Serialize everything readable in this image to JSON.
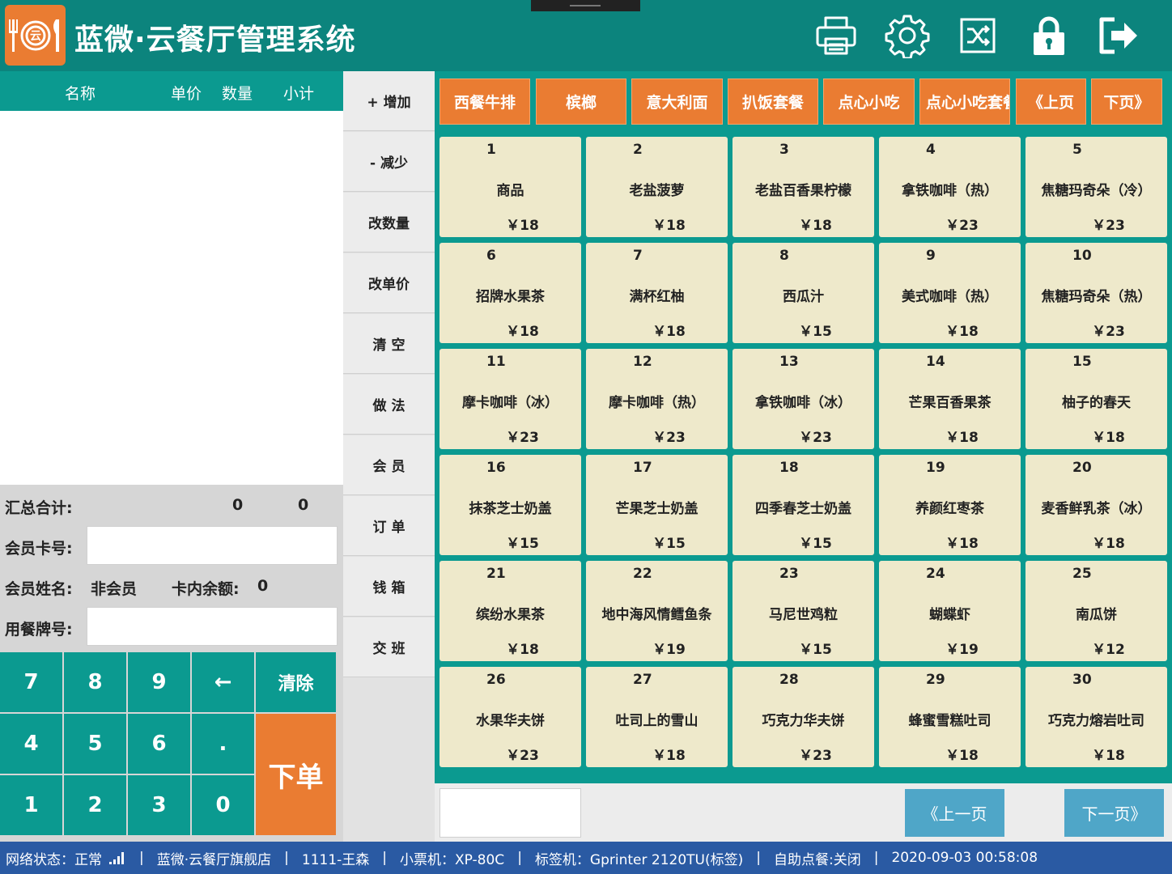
{
  "header": {
    "title": "蓝微·云餐厅管理系统",
    "icons": [
      "printer-icon",
      "settings-gear-icon",
      "shuffle-icon",
      "lock-icon",
      "exit-icon"
    ]
  },
  "order_table": {
    "col_name": "名称",
    "col_price": "单价",
    "col_qty": "数量",
    "col_subtotal": "小计"
  },
  "summary": {
    "total_label": "汇总合计:",
    "total_qty": "0",
    "total_amount": "0",
    "card_label": "会员卡号:",
    "member_name_label": "会员姓名:",
    "member_name": "非会员",
    "balance_label": "卡内余额:",
    "balance": "0",
    "table_tag_label": "用餐牌号:"
  },
  "numpad": {
    "k7": "7",
    "k8": "8",
    "k9": "9",
    "back": "←",
    "clear": "清除",
    "k4": "4",
    "k5": "5",
    "k6": "6",
    "dot": ".",
    "k1": "1",
    "k2": "2",
    "k3": "3",
    "k0": "0",
    "submit": "下单"
  },
  "actions": [
    "+ 增加",
    "- 减少",
    "改数量",
    "改单价",
    "清 空",
    "做 法",
    "会 员",
    "订 单",
    "钱 箱",
    "交 班"
  ],
  "categories": [
    "西餐牛排",
    "槟榔",
    "意大利面",
    "扒饭套餐",
    "点心小吃",
    "点心小吃套餐",
    "《上页",
    "下页》"
  ],
  "products": [
    {
      "num": "1",
      "name": "商品",
      "price": "￥18"
    },
    {
      "num": "2",
      "name": "老盐菠萝",
      "price": "￥18"
    },
    {
      "num": "3",
      "name": "老盐百香果柠檬",
      "price": "￥18"
    },
    {
      "num": "4",
      "name": "拿铁咖啡（热）",
      "price": "￥23"
    },
    {
      "num": "5",
      "name": "焦糖玛奇朵（冷）",
      "price": "￥23"
    },
    {
      "num": "6",
      "name": "招牌水果茶",
      "price": "￥18"
    },
    {
      "num": "7",
      "name": "满杯红柚",
      "price": "￥18"
    },
    {
      "num": "8",
      "name": "西瓜汁",
      "price": "￥15"
    },
    {
      "num": "9",
      "name": "美式咖啡（热）",
      "price": "￥18"
    },
    {
      "num": "10",
      "name": "焦糖玛奇朵（热）",
      "price": "￥23"
    },
    {
      "num": "11",
      "name": "摩卡咖啡（冰）",
      "price": "￥23"
    },
    {
      "num": "12",
      "name": "摩卡咖啡（热）",
      "price": "￥23"
    },
    {
      "num": "13",
      "name": "拿铁咖啡（冰）",
      "price": "￥23"
    },
    {
      "num": "14",
      "name": "芒果百香果茶",
      "price": "￥18"
    },
    {
      "num": "15",
      "name": "柚子的春天",
      "price": "￥18"
    },
    {
      "num": "16",
      "name": "抹茶芝士奶盖",
      "price": "￥15"
    },
    {
      "num": "17",
      "name": "芒果芝士奶盖",
      "price": "￥15"
    },
    {
      "num": "18",
      "name": "四季春芝士奶盖",
      "price": "￥15"
    },
    {
      "num": "19",
      "name": "养颜红枣茶",
      "price": "￥18"
    },
    {
      "num": "20",
      "name": "麦香鲜乳茶（冰）",
      "price": "￥18"
    },
    {
      "num": "21",
      "name": "缤纷水果茶",
      "price": "￥18"
    },
    {
      "num": "22",
      "name": "地中海风情鳕鱼条",
      "price": "￥19"
    },
    {
      "num": "23",
      "name": "马尼世鸡粒",
      "price": "￥15"
    },
    {
      "num": "24",
      "name": "蝴蝶虾",
      "price": "￥19"
    },
    {
      "num": "25",
      "name": "南瓜饼",
      "price": "￥12"
    },
    {
      "num": "26",
      "name": "水果华夫饼",
      "price": "￥23"
    },
    {
      "num": "27",
      "name": "吐司上的雪山",
      "price": "￥18"
    },
    {
      "num": "28",
      "name": "巧克力华夫饼",
      "price": "￥23"
    },
    {
      "num": "29",
      "name": "蜂蜜雪糕吐司",
      "price": "￥18"
    },
    {
      "num": "30",
      "name": "巧克力熔岩吐司",
      "price": "￥18"
    }
  ],
  "pager": {
    "prev": "《上一页",
    "next": "下一页》"
  },
  "status": {
    "network": "网络状态：正常",
    "store": "蓝微·云餐厅旗舰店",
    "user": "1111-王森",
    "receipt_printer": "小票机：XP-80C",
    "label_printer": "标签机：Gprinter 2120TU(标签)",
    "self_order": "自助点餐:关闭",
    "datetime": "2020-09-03 00:58:08",
    "separator": "|"
  },
  "colors": {
    "header_teal": "#0c847d",
    "teal": "#0b9a90",
    "orange": "#ea7c32",
    "tile": "#eee9cb",
    "pager_blue": "#4fa6c8",
    "status_blue": "#2a5aa3"
  }
}
